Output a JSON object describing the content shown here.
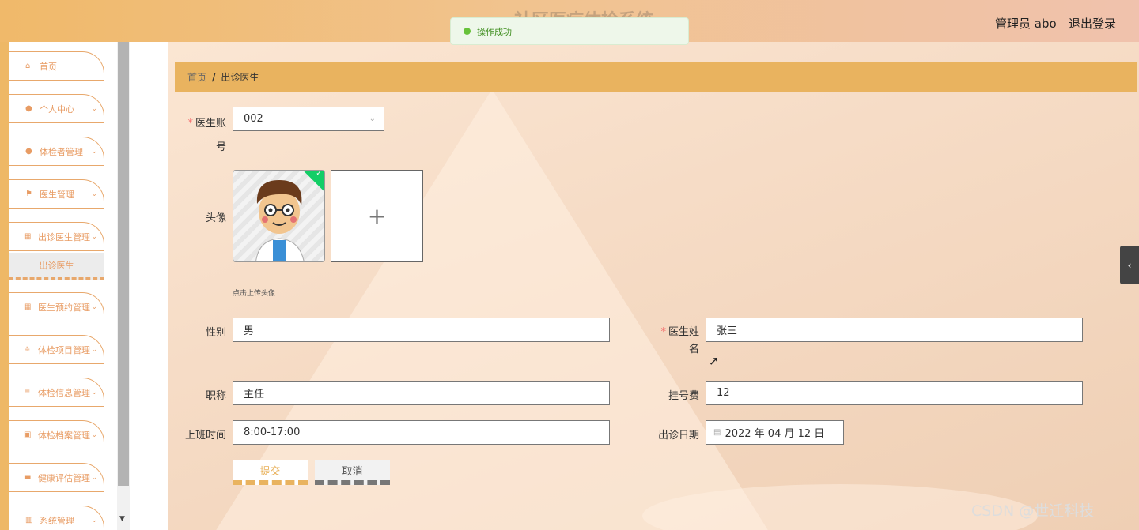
{
  "header": {
    "title": "社区医疗体检系统",
    "user": "管理员 abo",
    "logout": "退出登录"
  },
  "toast": {
    "message": "操作成功"
  },
  "sidebar": {
    "items": [
      {
        "label": "首页",
        "icon": "home-icon"
      },
      {
        "label": "个人中心",
        "icon": "user-icon"
      },
      {
        "label": "体检者管理",
        "icon": "user-icon"
      },
      {
        "label": "医生管理",
        "icon": "flag-icon"
      },
      {
        "label": "出诊医生管理",
        "icon": "grid-icon"
      },
      {
        "label": "医生预约管理",
        "icon": "grid-icon"
      },
      {
        "label": "体检项目管理",
        "icon": "sliders-icon"
      },
      {
        "label": "体检信息管理",
        "icon": "list-icon"
      },
      {
        "label": "体检档案管理",
        "icon": "clipboard-icon"
      },
      {
        "label": "健康评估管理",
        "icon": "monitor-icon"
      },
      {
        "label": "系统管理",
        "icon": "book-icon"
      }
    ],
    "submenu": "出诊医生"
  },
  "breadcrumb": {
    "home": "首页",
    "sep": "/",
    "current": "出诊医生"
  },
  "form": {
    "doctor_account_label": "医生账号",
    "doctor_account_value": "002",
    "avatar_label": "头像",
    "upload_plus": "+",
    "upload_tip": "点击上传头像",
    "gender_label": "性别",
    "gender_value": "男",
    "doctor_name_label": "医生姓名",
    "doctor_name_value": "张三",
    "title_label": "职称",
    "title_value": "主任",
    "fee_label": "挂号费",
    "fee_value": "12",
    "hours_label": "上班时间",
    "hours_value": "8:00-17:00",
    "date_label": "出诊日期",
    "date_value": "2022 年 04 月 12 日",
    "submit": "提交",
    "cancel": "取消"
  },
  "watermark": "CSDN @世迁科技",
  "colors": {
    "accent": "#e9b35f",
    "success": "#67c23a",
    "required": "#f56c6c"
  }
}
